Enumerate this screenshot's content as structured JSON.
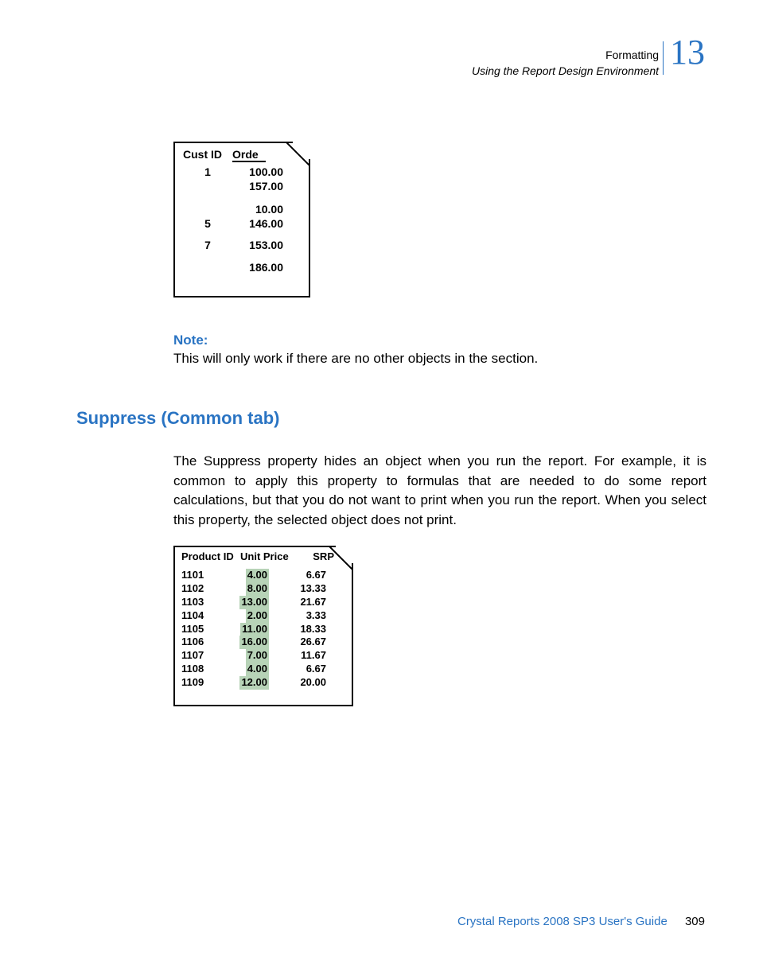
{
  "header": {
    "breadcrumb_top": "Formatting",
    "breadcrumb_bottom": "Using the Report Design Environment",
    "chapter_number": "13"
  },
  "figure1": {
    "headers": {
      "col1": "Cust ID",
      "col2": "Orde"
    },
    "rows": [
      {
        "cust": "1",
        "val": "100.00"
      },
      {
        "cust": "",
        "val": "157.00"
      },
      {
        "cust": "",
        "val": "10.00"
      },
      {
        "cust": "5",
        "val": "146.00"
      },
      {
        "cust": "7",
        "val": "153.00"
      },
      {
        "cust": "",
        "val": "186.00"
      }
    ]
  },
  "note": {
    "label": "Note:",
    "text": "This will only work if there are no other objects in the section."
  },
  "section_heading": "Suppress (Common tab)",
  "body_paragraph": "The Suppress property hides an object when you run the report. For example, it is common to apply this property to formulas that are needed to do some report calculations, but that you do not want to print when you run the report. When you select this property, the selected object does not print.",
  "figure2": {
    "headers": {
      "h1": "Product ID",
      "h2": "Unit Price",
      "h3": "SRP"
    },
    "rows": [
      {
        "pid": "1101",
        "price": "4.00",
        "srp": "6.67"
      },
      {
        "pid": "1102",
        "price": "8.00",
        "srp": "13.33"
      },
      {
        "pid": "1103",
        "price": "13.00",
        "srp": "21.67"
      },
      {
        "pid": "1104",
        "price": "2.00",
        "srp": "3.33"
      },
      {
        "pid": "1105",
        "price": "11.00",
        "srp": "18.33"
      },
      {
        "pid": "1106",
        "price": "16.00",
        "srp": "26.67"
      },
      {
        "pid": "1107",
        "price": "7.00",
        "srp": "11.67"
      },
      {
        "pid": "1108",
        "price": "4.00",
        "srp": "6.67"
      },
      {
        "pid": "1109",
        "price": "12.00",
        "srp": "20.00"
      }
    ]
  },
  "footer": {
    "title": "Crystal Reports 2008 SP3 User's Guide",
    "page": "309"
  }
}
